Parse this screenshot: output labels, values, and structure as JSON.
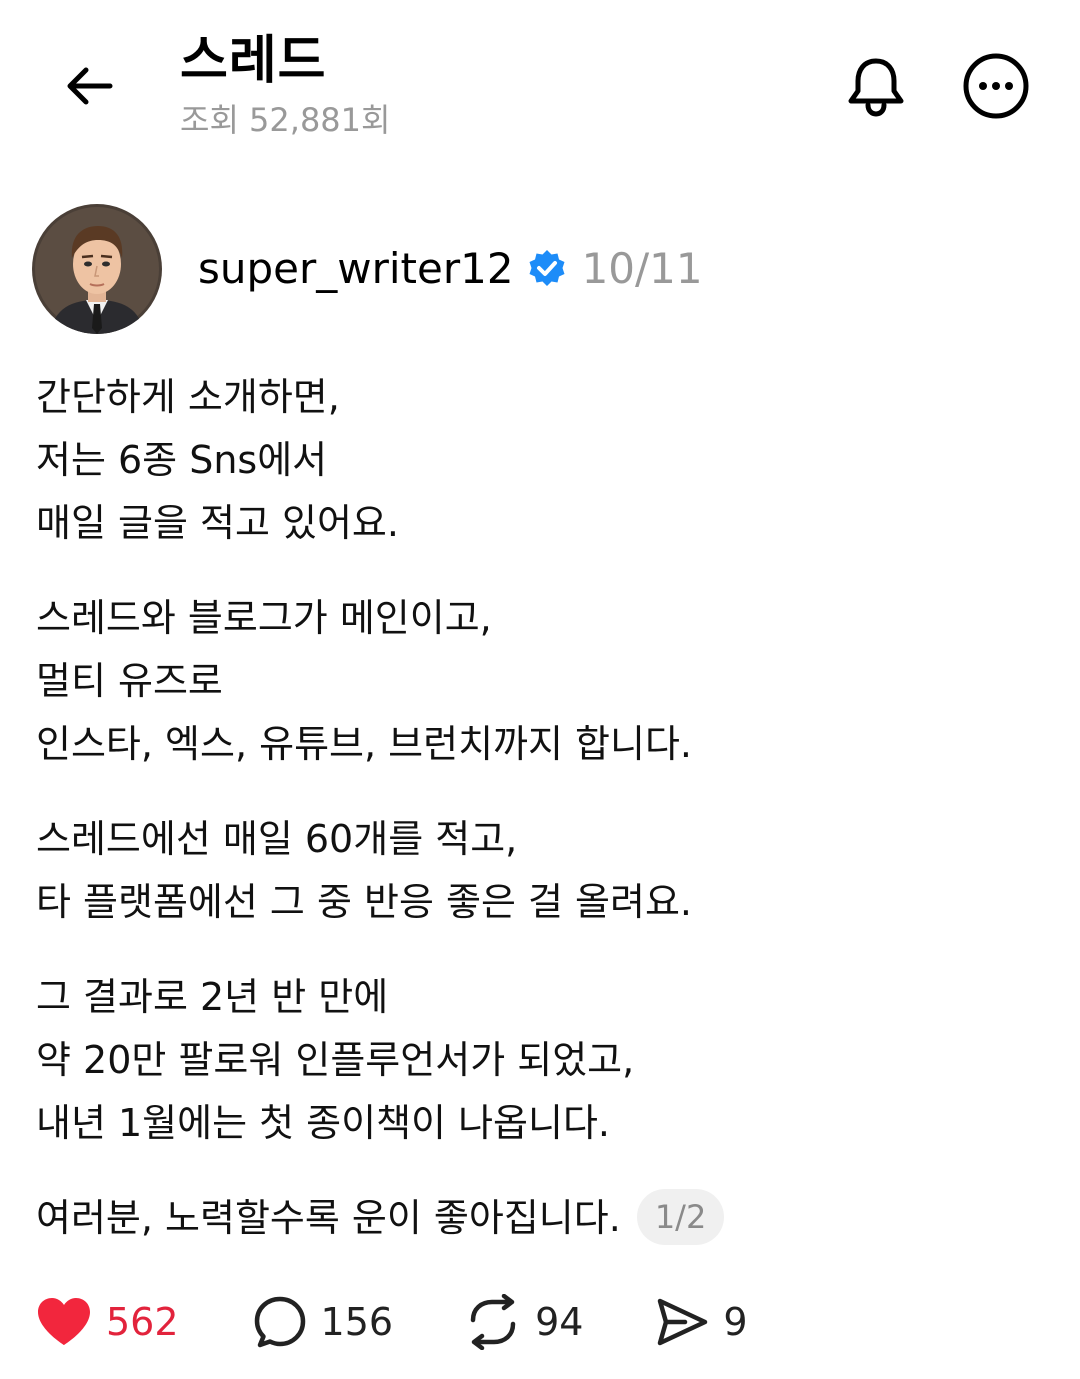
{
  "header": {
    "title": "스레드",
    "views": "조회 52,881회"
  },
  "post": {
    "username": "super_writer12",
    "date": "10/11",
    "paragraphs": [
      [
        "간단하게 소개하면,",
        "저는 6종 Sns에서",
        "매일 글을 적고 있어요."
      ],
      [
        "스레드와 블로그가 메인이고,",
        "멀티 유즈로",
        "인스타, 엑스, 유튜브, 브런치까지 합니다."
      ],
      [
        "스레드에선 매일 60개를 적고,",
        "타 플랫폼에선 그 중 반응 좋은 걸 올려요."
      ],
      [
        "그 결과로 2년 반 만에",
        "약 20만 팔로워 인플루언서가 되었고,",
        "내년 1월에는 첫 종이책이 나옵니다."
      ],
      [
        "여러분, 노력할수록 운이 좋아집니다."
      ]
    ],
    "page_indicator": "1/2"
  },
  "actions": {
    "likes": "562",
    "replies": "156",
    "reposts": "94",
    "shares": "9"
  },
  "icons": {
    "back": "back-arrow-icon",
    "bell": "bell-icon",
    "more": "more-options-icon",
    "verified": "verified-badge-icon",
    "like": "heart-icon",
    "reply": "comment-icon",
    "repost": "repost-icon",
    "share": "send-icon"
  },
  "colors": {
    "like_red": "#e2233c",
    "verified_blue": "#1d8cf8",
    "muted_gray": "#999999"
  }
}
